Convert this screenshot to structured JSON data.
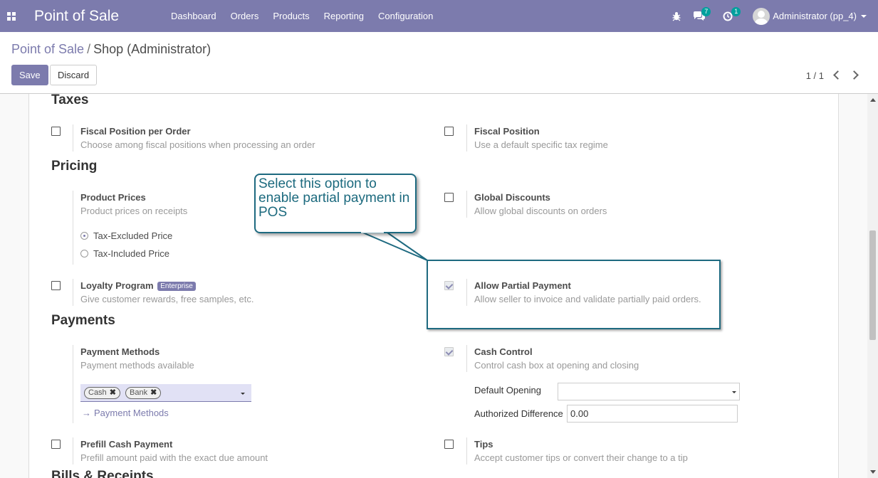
{
  "navbar": {
    "brand": "Point of Sale",
    "menu": [
      "Dashboard",
      "Orders",
      "Products",
      "Reporting",
      "Configuration"
    ],
    "chat_count": "7",
    "activity_count": "1",
    "user_name": "Administrator (pp_4)",
    "icons": [
      "apps-icon",
      "bug-icon",
      "chat-icon",
      "activity-clock-icon",
      "avatar"
    ]
  },
  "control_panel": {
    "breadcrumb_parent": "Point of Sale",
    "breadcrumb_separator": "/",
    "breadcrumb_current": "Shop (Administrator)",
    "save_label": "Save",
    "discard_label": "Discard",
    "pager": "1 / 1"
  },
  "sections": {
    "taxes": "Taxes",
    "pricing": "Pricing",
    "payments": "Payments",
    "bills": "Bills & Receipts"
  },
  "settings": {
    "fiscal_position_per_order": {
      "label": "Fiscal Position per Order",
      "desc": "Choose among fiscal positions when processing an order",
      "checked": false
    },
    "fiscal_position": {
      "label": "Fiscal Position",
      "desc": "Use a default specific tax regime",
      "checked": false
    },
    "product_prices": {
      "label": "Product Prices",
      "desc": "Product prices on receipts",
      "options": [
        "Tax-Excluded Price",
        "Tax-Included Price"
      ],
      "selected": "Tax-Excluded Price"
    },
    "global_discounts": {
      "label": "Global Discounts",
      "desc": "Allow global discounts on orders",
      "checked": false
    },
    "loyalty_program": {
      "label": "Loyalty Program",
      "badge": "Enterprise",
      "desc": "Give customer rewards, free samples, etc.",
      "checked": false
    },
    "allow_partial_payment": {
      "label": "Allow Partial Payment",
      "desc": "Allow seller to invoice and validate partially paid orders.",
      "checked": true
    },
    "payment_methods": {
      "label": "Payment Methods",
      "desc": "Payment methods available",
      "tags": [
        "Cash",
        "Bank"
      ],
      "tag_remove": "✖",
      "link": "Payment Methods"
    },
    "cash_control": {
      "label": "Cash Control",
      "desc": "Control cash box at opening and closing",
      "checked": true,
      "default_opening_label": "Default Opening",
      "default_opening_value": "",
      "authorized_difference_label": "Authorized Difference",
      "authorized_difference_value": "0.00"
    },
    "prefill_cash_payment": {
      "label": "Prefill Cash Payment",
      "desc": "Prefill amount paid with the exact due amount",
      "checked": false
    },
    "tips": {
      "label": "Tips",
      "desc": "Accept customer tips or convert their change to a tip",
      "checked": false
    }
  },
  "callout": {
    "text": "Select this option to enable partial payment in POS"
  },
  "colors": {
    "brand": "#7c7bad",
    "callout": "#1e6a80",
    "badge": "#00a09d"
  }
}
